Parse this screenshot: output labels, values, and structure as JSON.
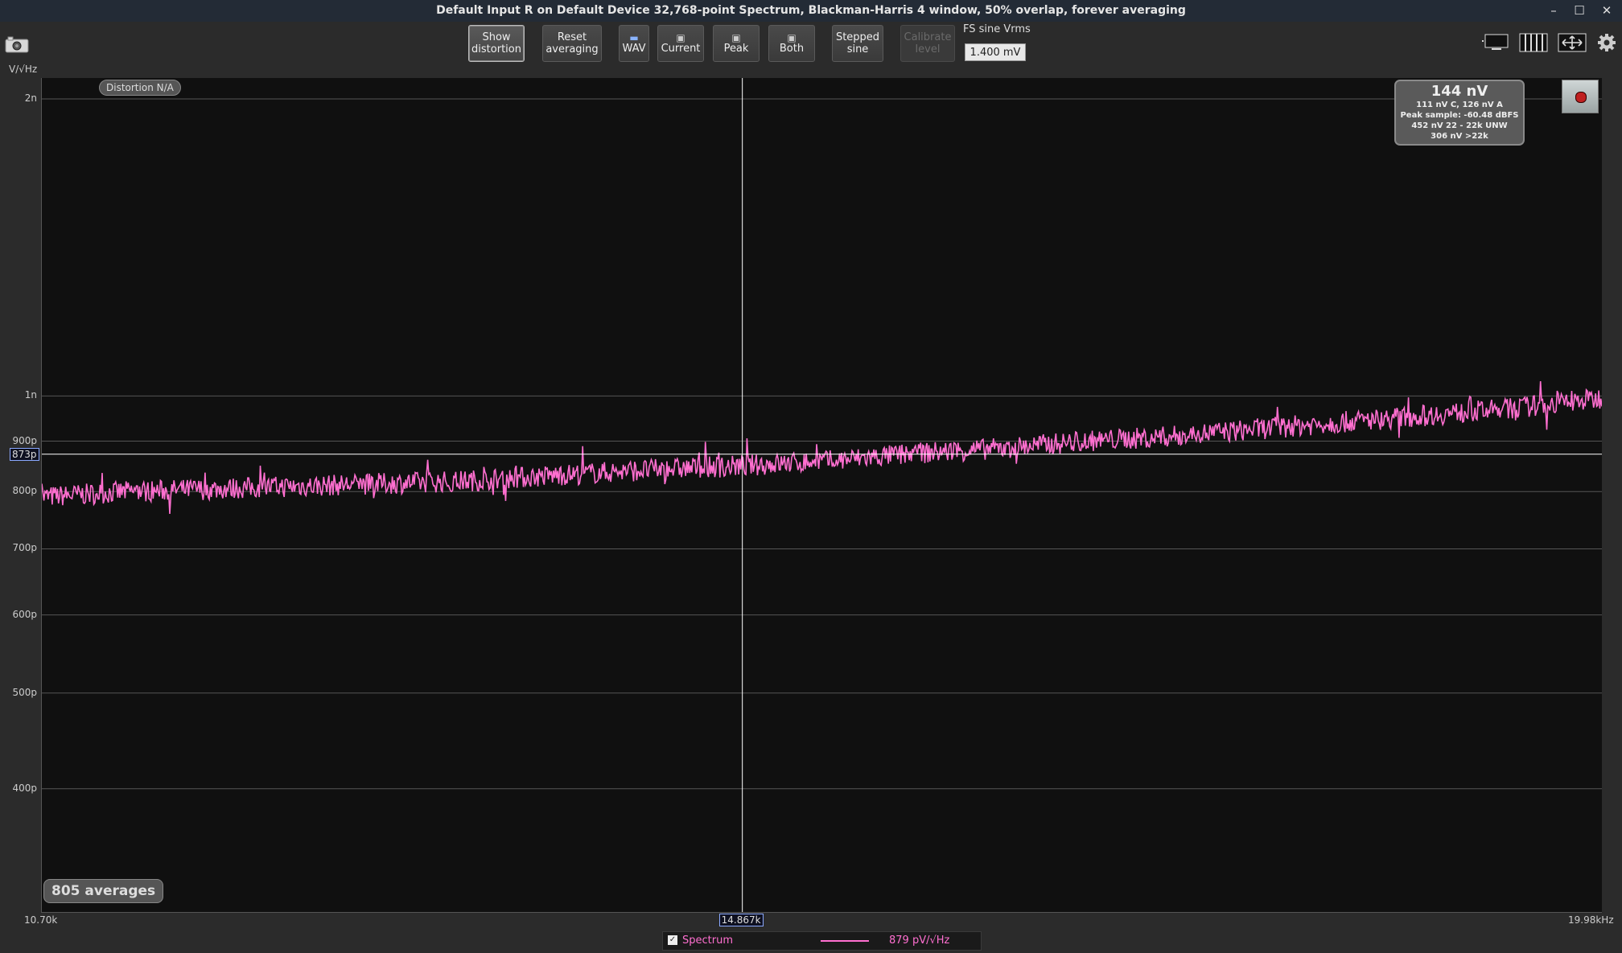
{
  "window": {
    "title": "Default Input R on Default Device 32,768-point Spectrum, Blackman-Harris 4 window, 50% overlap, forever averaging",
    "controls": [
      "–",
      "☐",
      "✕"
    ]
  },
  "toolbar": {
    "show_distortion": [
      "Show",
      "distortion"
    ],
    "reset_averaging": [
      "Reset",
      "averaging"
    ],
    "wav": "WAV",
    "current": "Current",
    "peak": "Peak",
    "both": "Both",
    "stepped_sine": [
      "Stepped",
      "sine"
    ],
    "calibrate_level": [
      "Calibrate",
      "level"
    ],
    "fs_sine_label": "FS sine Vrms",
    "fs_sine_value": "1.400 mV"
  },
  "plot": {
    "unit_label": "V/√Hz",
    "distortion_badge": "Distortion N/A",
    "averages_badge": "805 averages",
    "cursor_y_label": "873p",
    "cursor_x_label": "14.867k",
    "infobox": {
      "main": "144 nV",
      "lines": [
        "111 nV C, 126 nV A",
        "Peak sample: -60.48 dBFS",
        "452 nV 22 - 22k UNW",
        "306 nV >22k"
      ]
    },
    "legend": {
      "checked": "✓",
      "name": "Spectrum",
      "value": "879 pV/√Hz",
      "color": "#ff6fd0"
    },
    "background": "#101010",
    "gridline_color": "#555555",
    "cursor_color": "#ffffff"
  },
  "chart_data": {
    "type": "line",
    "title": "",
    "xlabel": "",
    "ylabel": "V/√Hz",
    "xlim": [
      10700,
      19980
    ],
    "ylim_log": [
      3e-10,
      2.1e-09
    ],
    "y_scale": "log",
    "x_tick_labels": [
      {
        "value": 10700,
        "label": "10.70k"
      },
      {
        "value": 19980,
        "label": "19.98kHz"
      }
    ],
    "y_tick_labels": [
      {
        "value": 2e-09,
        "label": "2n"
      },
      {
        "value": 1e-09,
        "label": "1n"
      },
      {
        "value": 9e-10,
        "label": "900p"
      },
      {
        "value": 8e-10,
        "label": "800p"
      },
      {
        "value": 7e-10,
        "label": "700p"
      },
      {
        "value": 6e-10,
        "label": "600p"
      },
      {
        "value": 5e-10,
        "label": "500p"
      },
      {
        "value": 4e-10,
        "label": "400p"
      }
    ],
    "grid": true,
    "cursor": {
      "x": 14867,
      "y": 8.73e-10
    },
    "series": [
      {
        "name": "Spectrum",
        "color": "#ff6fd0",
        "x": [
          10700,
          11200,
          11700,
          12200,
          12700,
          13200,
          13700,
          14200,
          14867,
          15400,
          15900,
          16400,
          16900,
          17400,
          17900,
          18400,
          18900,
          19400,
          19980
        ],
        "y": [
          7.9e-10,
          8e-10,
          8.05e-10,
          8.1e-10,
          8.15e-10,
          8.2e-10,
          8.3e-10,
          8.4e-10,
          8.5e-10,
          8.6e-10,
          8.75e-10,
          8.85e-10,
          9e-10,
          9.1e-10,
          9.25e-10,
          9.4e-10,
          9.55e-10,
          9.7e-10,
          9.95e-10
        ],
        "noise_amplitude_fraction": 0.025
      }
    ]
  }
}
